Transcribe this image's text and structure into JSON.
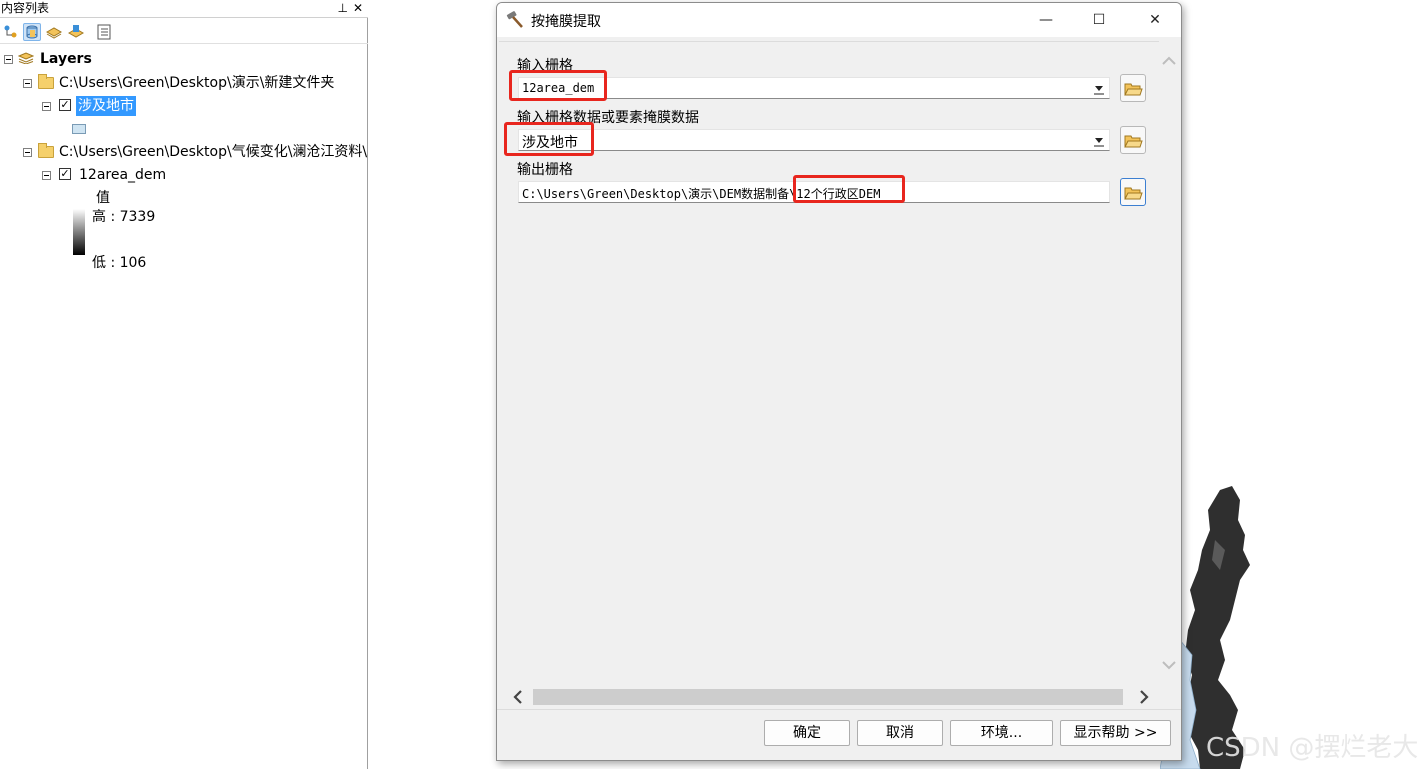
{
  "toc": {
    "title": "内容列表",
    "pin_glyph": "ᵖ",
    "close_glyph": "×",
    "toolbar": [
      {
        "name": "list-by-drawing-order",
        "icon": "list-by-drawing-order-icon"
      },
      {
        "name": "list-by-source",
        "icon": "list-by-source-icon",
        "active": true
      },
      {
        "name": "list-by-visibility",
        "icon": "list-by-visibility-icon"
      },
      {
        "name": "list-by-selection",
        "icon": "list-by-selection-icon"
      },
      {
        "name": "options",
        "icon": "options-icon"
      }
    ],
    "root_label": "Layers",
    "folder1_path": "C:\\Users\\Green\\Desktop\\演示\\新建文件夹",
    "layer1_name": "涉及地市",
    "folder2_path": "C:\\Users\\Green\\Desktop\\气候变化\\澜沧江资料\\",
    "layer2_name": "12area_dem",
    "legend_heading": "值",
    "legend_high": "高 : 7339",
    "legend_low": "低 : 106"
  },
  "dialog": {
    "title": "按掩膜提取",
    "minimize_glyph": "—",
    "maximize_glyph": "☐",
    "close_glyph": "✕",
    "input_raster_label": "输入栅格",
    "input_raster_value": "12area_dem",
    "mask_label": "输入栅格数据或要素掩膜数据",
    "mask_value": "涉及地市",
    "output_label": "输出栅格",
    "output_value": "C:\\Users\\Green\\Desktop\\演示\\DEM数据制备\\12个行政区DEM",
    "buttons": {
      "ok": "确定",
      "cancel": "取消",
      "environments": "环境...",
      "show_help": "显示帮助 >>"
    }
  },
  "watermark": "CSDN @摆烂老大",
  "colors": {
    "highlight": "#e8261e",
    "selected_layer_bg": "#3399ff"
  }
}
